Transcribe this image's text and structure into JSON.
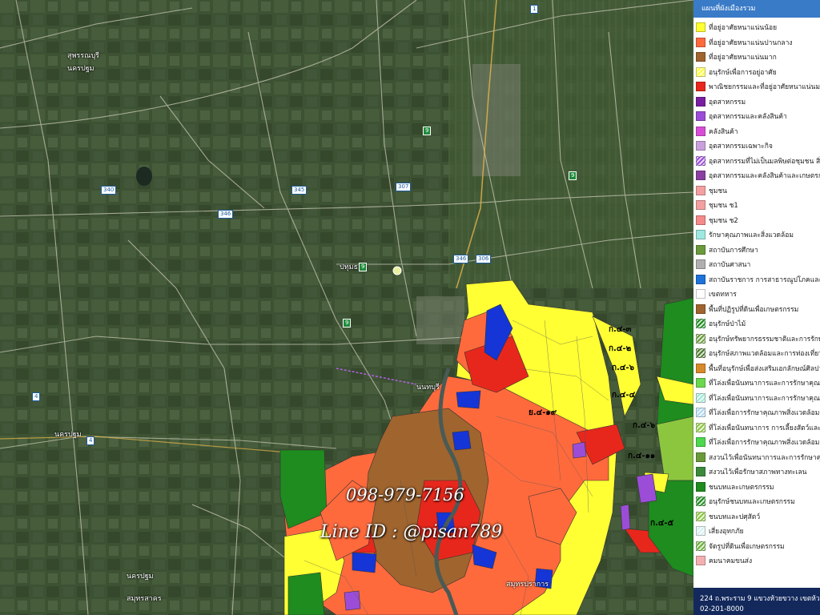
{
  "colors": {
    "base_map": "#3d5233",
    "low_density": "#ffff33",
    "medium_density": "#ff6a3d",
    "high_density": "#a0642e",
    "commercial": "#e8271c",
    "institution": "#1535d6",
    "rural_agriculture": "#1e8c1e",
    "rural_light": "#8cc63f",
    "industry": "#9b4dd8",
    "legend_header": "#3a7bc8",
    "legend_footer": "#13295c"
  },
  "map": {
    "place_labels": [
      "สุพรรณบุรี",
      "นครปฐม",
      "ปทุมธานี",
      "นนทบุรี",
      "นครปฐม",
      "นครปฐม",
      "สมุทรสาคร",
      "สมุทรปราการ"
    ],
    "route_shields": [
      "340",
      "346",
      "345",
      "9",
      "1",
      "9",
      "9",
      "346",
      "307",
      "306",
      "4",
      "4",
      "9"
    ],
    "zone_codes": [
      "ก.๔-๓",
      "ก.๔-๒",
      "ก.๔-๖",
      "ก.๔-๔",
      "ย.๔-๑๙",
      "ก.๔-๑๑",
      "ก.๔-๖",
      "ก.๔-๕"
    ]
  },
  "watermark": {
    "phone": "098-979-7156",
    "line": "Line ID : @pisan789"
  },
  "legend": {
    "header": "แผนที่ผังเมืองรวม",
    "items": [
      {
        "label": "ที่อยู่อาศัยหนาแน่นน้อย",
        "color": "#ffff33",
        "hatch": false
      },
      {
        "label": "ที่อยู่อาศัยหนาแน่นปานกลาง",
        "color": "#ff6a3d",
        "hatch": false
      },
      {
        "label": "ที่อยู่อาศัยหนาแน่นมาก",
        "color": "#a0642e",
        "hatch": false
      },
      {
        "label": "อนุรักษ์เพื่อการอยู่อาศัย",
        "color": "#ffff33",
        "hatch": true
      },
      {
        "label": "พาณิชยกรรมและที่อยู่อาศัยหนาแน่นมาก",
        "color": "#e8271c",
        "hatch": false
      },
      {
        "label": "อุตสาหกรรม",
        "color": "#7a1fa0",
        "hatch": false
      },
      {
        "label": "อุตสาหกรรมและคลังสินค้า",
        "color": "#9b4dd8",
        "hatch": false
      },
      {
        "label": "คลังสินค้า",
        "color": "#d84dd8",
        "hatch": false
      },
      {
        "label": "อุตสาหกรรมเฉพาะกิจ",
        "color": "#c9a0dc",
        "hatch": false
      },
      {
        "label": "อุตสาหกรรมที่ไม่เป็นมลพิษต่อชุมชน สิ่ง",
        "color": "#9b4dd8",
        "hatch": true
      },
      {
        "label": "อุตสาหกรรมและคลังสินค้าและเกษตรก",
        "color": "#8a3fa0",
        "hatch": false
      },
      {
        "label": "ชุมชน",
        "color": "#f4a0a0",
        "hatch": false
      },
      {
        "label": "ชุมชน ช1",
        "color": "#f4a0a0",
        "hatch": false
      },
      {
        "label": "ชุมชน ช2",
        "color": "#f48a8a",
        "hatch": false
      },
      {
        "label": "รักษาคุณภาพและสิ่งแวดล้อม",
        "color": "#9ee8e0",
        "hatch": false
      },
      {
        "label": "สถาบันการศึกษา",
        "color": "#6a9a3a",
        "hatch": false
      },
      {
        "label": "สถาบันศาสนา",
        "color": "#b0b0b0",
        "hatch": false
      },
      {
        "label": "สถาบันราชการ การสาธารณูปโภคและสิ",
        "color": "#1e73d8",
        "hatch": false
      },
      {
        "label": "เขตทหาร",
        "color": "#ffffff",
        "hatch": false
      },
      {
        "label": "พื้นที่ปฏิรูปที่ดินเพื่อเกษตรกรรม",
        "color": "#a0642e",
        "hatch": false
      },
      {
        "label": "อนุรักษ์ป่าไม้",
        "color": "#1e8c1e",
        "hatch": true
      },
      {
        "label": "อนุรักษ์ทรัพยากรธรรมชาติและการรักษ",
        "color": "#6a9a3a",
        "hatch": true
      },
      {
        "label": "อนุรักษ์สภาพแวดล้อมและการท่องเที่ยว",
        "color": "#4a7a2a",
        "hatch": true
      },
      {
        "label": "พื้นที่อนุรักษ์เพื่อส่งเสริมเอกลักษณ์ศิลปวั",
        "color": "#d88a2a",
        "hatch": false
      },
      {
        "label": "ที่โล่งเพื่อนันทนาการและการรักษาคุณภ",
        "color": "#6ad84d",
        "hatch": false
      },
      {
        "label": "ที่โล่งเพื่อนันทนาการและการรักษาคุณภ",
        "color": "#a0e8d8",
        "hatch": true
      },
      {
        "label": "ที่โล่งเพื่อการรักษาคุณภาพสิ่งแวดล้อมก",
        "color": "#b0d8f0",
        "hatch": true
      },
      {
        "label": "ที่โล่งเพื่อนันทนาการ การเลี้ยงสัตว์และก",
        "color": "#8cc63f",
        "hatch": true
      },
      {
        "label": "ที่โล่งเพื่อการรักษาคุณภาพสิ่งแวดล้อม",
        "color": "#4dd84d",
        "hatch": false
      },
      {
        "label": "สงวนไว้เพื่อนันทนาการและการรักษาคุณ",
        "color": "#6a9a3a",
        "hatch": false
      },
      {
        "label": "สงวนไว้เพื่อรักษาสภาพทางทะเลน",
        "color": "#3a8a3a",
        "hatch": false
      },
      {
        "label": "ชนบทและเกษตรกรรม",
        "color": "#1e8c1e",
        "hatch": false
      },
      {
        "label": "อนุรักษ์ชนบทและเกษตรกรรม",
        "color": "#1e8c1e",
        "hatch": true
      },
      {
        "label": "ชนบทและปศุสัตว์",
        "color": "#8cc63f",
        "hatch": true
      },
      {
        "label": "เสี่ยงอุทกภัย",
        "color": "#d8f0f0",
        "hatch": true
      },
      {
        "label": "จัดรูปที่ดินเพื่อเกษตรกรรม",
        "color": "#6ab03a",
        "hatch": true
      },
      {
        "label": "คมนาคมขนส่ง",
        "color": "#f4b0b0",
        "hatch": false
      }
    ],
    "footer_line1": "224 ถ.พระราม 9 แขวงห้วยขวาง เขตห้วย",
    "footer_line2": "02-201-8000"
  }
}
